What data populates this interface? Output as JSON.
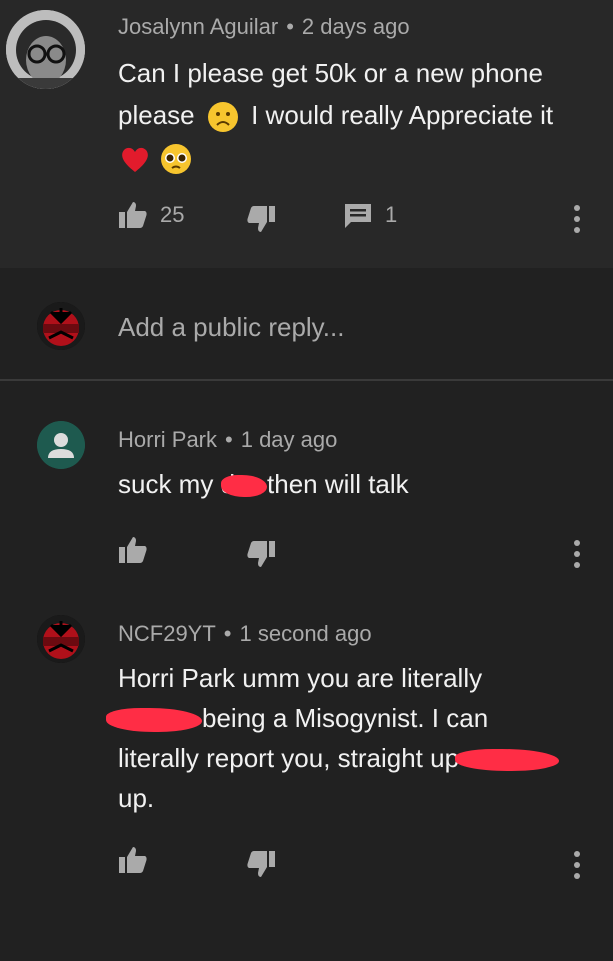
{
  "comments": [
    {
      "author": "Josalynn Aguilar",
      "time": "2 days ago",
      "text_line1": "Can I please get 50k or a new phone",
      "text_line2a": "please",
      "text_line2b": "I would really Appreciate it",
      "emojis": [
        "frowning-face",
        "red-heart",
        "pleading-face"
      ],
      "likes": "25",
      "replies": "1"
    },
    {
      "author": "Horri Park",
      "time": "1 day ago",
      "text_a": "suck my d",
      "text_b": "then will talk",
      "likes": "",
      "avatar_color": "#1e5a4f"
    },
    {
      "author": "NCF29YT",
      "time": "1 second ago",
      "line1": "Horri Park umm you are literally",
      "line2": "being a Misogynist. I can",
      "line3": "literally report you, straight up",
      "line4": "up.",
      "likes": ""
    }
  ],
  "reply_bar": {
    "placeholder": "Add a public reply..."
  },
  "colors": {
    "background": "#212121",
    "top_comment_bg": "#282828",
    "redaction": "#ff2d45"
  }
}
